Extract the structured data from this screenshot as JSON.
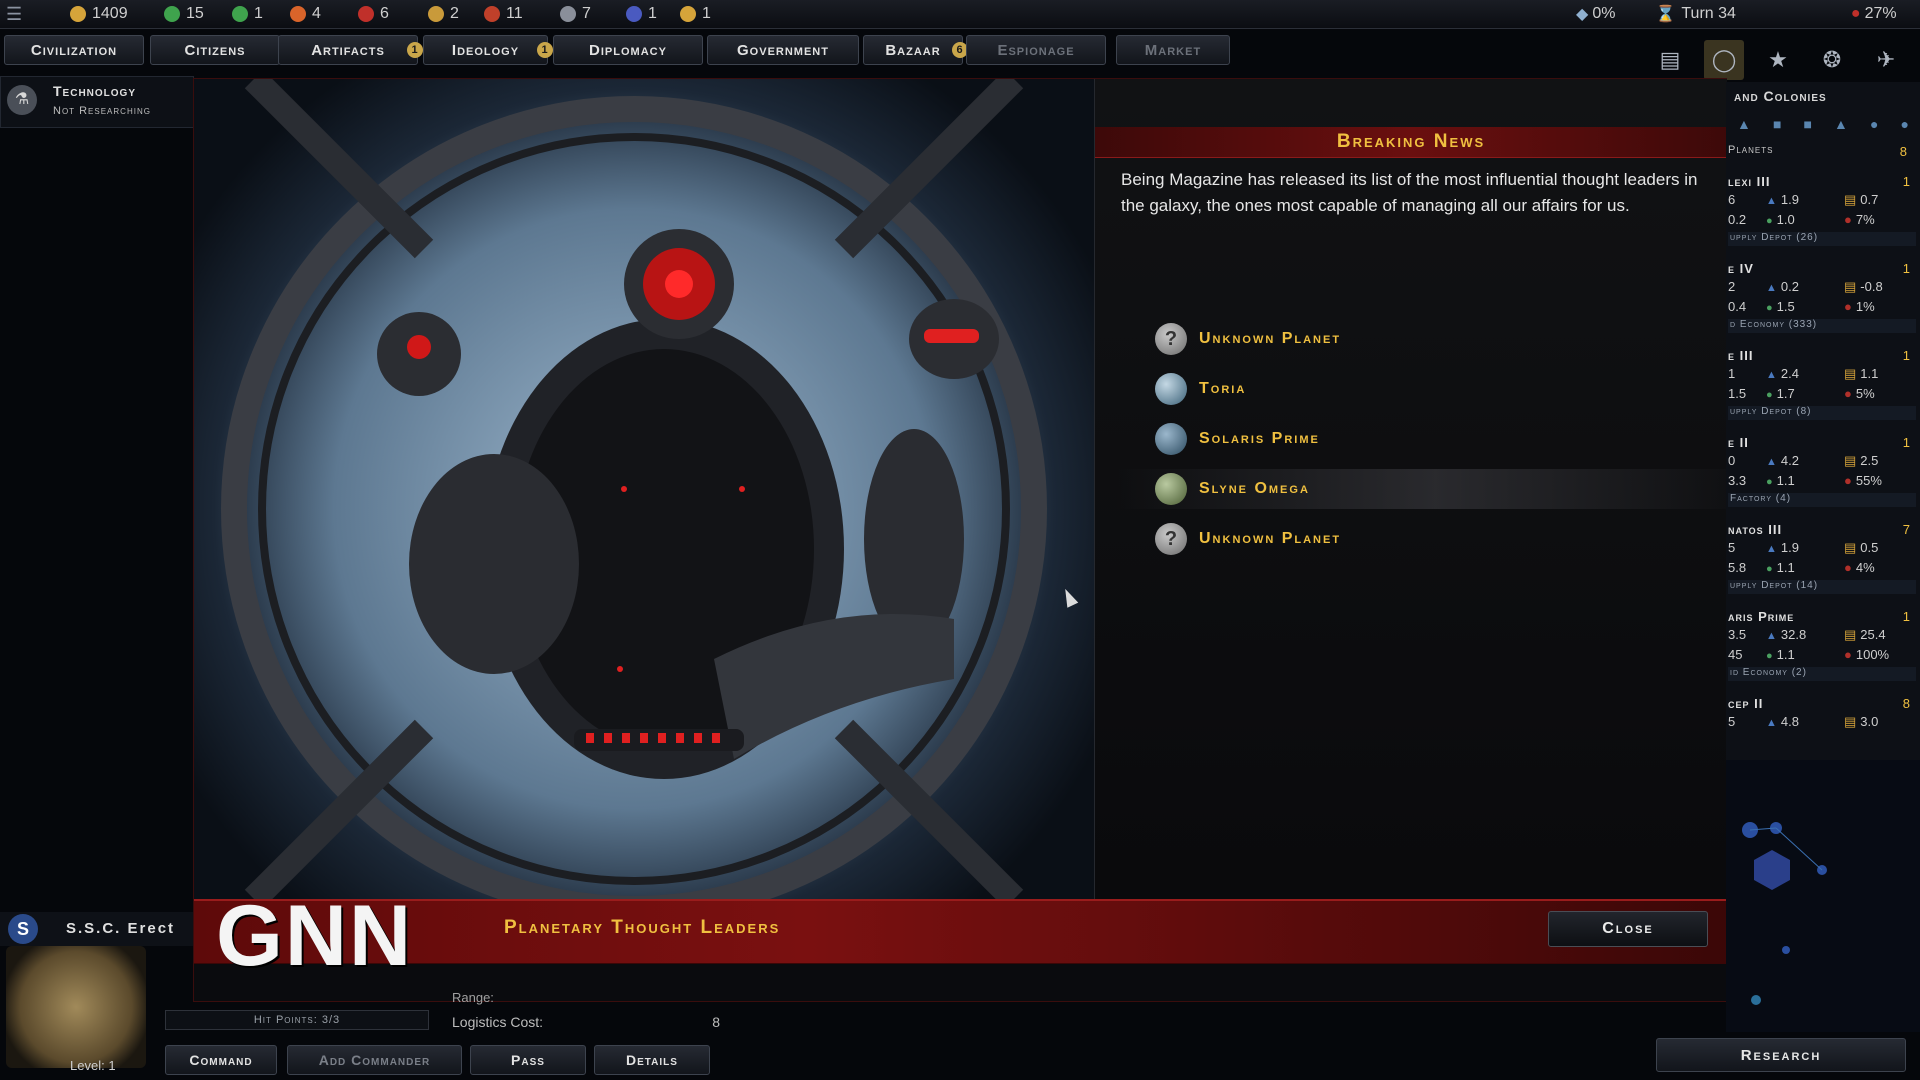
{
  "resources": [
    {
      "name": "credits",
      "value": "1409",
      "color": "#d6a43a"
    },
    {
      "name": "population",
      "value": "15",
      "color": "#3fa34d"
    },
    {
      "name": "influence",
      "value": "1",
      "color": "#3fa34d"
    },
    {
      "name": "manufacturing",
      "value": "4",
      "color": "#d9642a"
    },
    {
      "name": "military",
      "value": "6",
      "color": "#c0302a"
    },
    {
      "name": "approval",
      "value": "2",
      "color": "#c99a3a"
    },
    {
      "name": "research",
      "value": "11",
      "color": "#c0402a"
    },
    {
      "name": "ships",
      "value": "7",
      "color": "#8a8f9a"
    },
    {
      "name": "starbases",
      "value": "1",
      "color": "#4a5ac0"
    },
    {
      "name": "artifacts",
      "value": "1",
      "color": "#d6a43a"
    }
  ],
  "status": {
    "percent_a": "0%",
    "turn": "Turn 34",
    "percent_b": "27%"
  },
  "tabs": [
    {
      "label": "Civilization",
      "badge": ""
    },
    {
      "label": "Citizens",
      "badge": ""
    },
    {
      "label": "Artifacts",
      "badge": "1"
    },
    {
      "label": "Ideology",
      "badge": "1"
    },
    {
      "label": "Diplomacy",
      "badge": ""
    },
    {
      "label": "Government",
      "badge": ""
    },
    {
      "label": "Bazaar",
      "badge": "6"
    },
    {
      "label": "Espionage",
      "badge": ""
    },
    {
      "label": "Market",
      "badge": ""
    }
  ],
  "technology": {
    "title": "Technology",
    "status": "Not Researching"
  },
  "dialog": {
    "header": "Breaking News",
    "body": "Being Magazine has released its list of the most influential thought leaders in the galaxy, the ones most capable of managing all our affairs for us.",
    "planets": [
      {
        "name": "Unknown Planet",
        "icon": "question-icon"
      },
      {
        "name": "Toria",
        "icon": "planet-icon"
      },
      {
        "name": "Solaris Prime",
        "icon": "planet-icon"
      },
      {
        "name": "Slyne Omega",
        "icon": "planet-icon"
      },
      {
        "name": "Unknown Planet",
        "icon": "question-icon"
      }
    ],
    "logo": "GNN",
    "headline": "Planetary Thought Leaders",
    "close_label": "Close"
  },
  "ship": {
    "name": "S.S.C. Erect",
    "level_label": "Level:",
    "level": "1",
    "hit_points": "Hit Points: 3/3",
    "range_label": "Range:",
    "logistics_label": "Logistics Cost:",
    "logistics_value": "8",
    "buttons": [
      "Command",
      "Add Commander",
      "Pass",
      "Details"
    ]
  },
  "sidebar": {
    "title": "and Colonies",
    "planets_label": "Planets",
    "planets_count": "8",
    "colonies": [
      {
        "name": "lexi III",
        "val": "1",
        "r1a": "6",
        "r1b": "1.9",
        "r1c": "0.7",
        "r2a": "0.2",
        "r2b": "1.0",
        "r2c": "7%",
        "project": "upply Depot (26)"
      },
      {
        "name": "e IV",
        "val": "1",
        "r1a": "2",
        "r1b": "0.2",
        "r1c": "-0.8",
        "r2a": "0.4",
        "r2b": "1.5",
        "r2c": "1%",
        "project": "d Economy (333)"
      },
      {
        "name": "e III",
        "val": "1",
        "r1a": "1",
        "r1b": "2.4",
        "r1c": "1.1",
        "r2a": "1.5",
        "r2b": "1.7",
        "r2c": "5%",
        "project": "upply Depot (8)"
      },
      {
        "name": "e II",
        "val": "1",
        "r1a": "0",
        "r1b": "4.2",
        "r1c": "2.5",
        "r2a": "3.3",
        "r2b": "1.1",
        "r2c": "55%",
        "project": "Factory (4)"
      },
      {
        "name": "natos III",
        "val": "7",
        "r1a": "5",
        "r1b": "1.9",
        "r1c": "0.5",
        "r2a": "5.8",
        "r2b": "1.1",
        "r2c": "4%",
        "project": "upply Depot (14)"
      },
      {
        "name": "aris Prime",
        "val": "1",
        "r1a": "3.5",
        "r1b": "32.8",
        "r1c": "25.4",
        "r2a": "45",
        "r2b": "1.1",
        "r2c": "100%",
        "project": "id Economy (2)"
      },
      {
        "name": "cep II",
        "val": "8",
        "r1a": "5",
        "r1b": "4.8",
        "r1c": "3.0",
        "r2a": "",
        "r2b": "",
        "r2c": "",
        "project": ""
      }
    ]
  },
  "research_label": "Research"
}
